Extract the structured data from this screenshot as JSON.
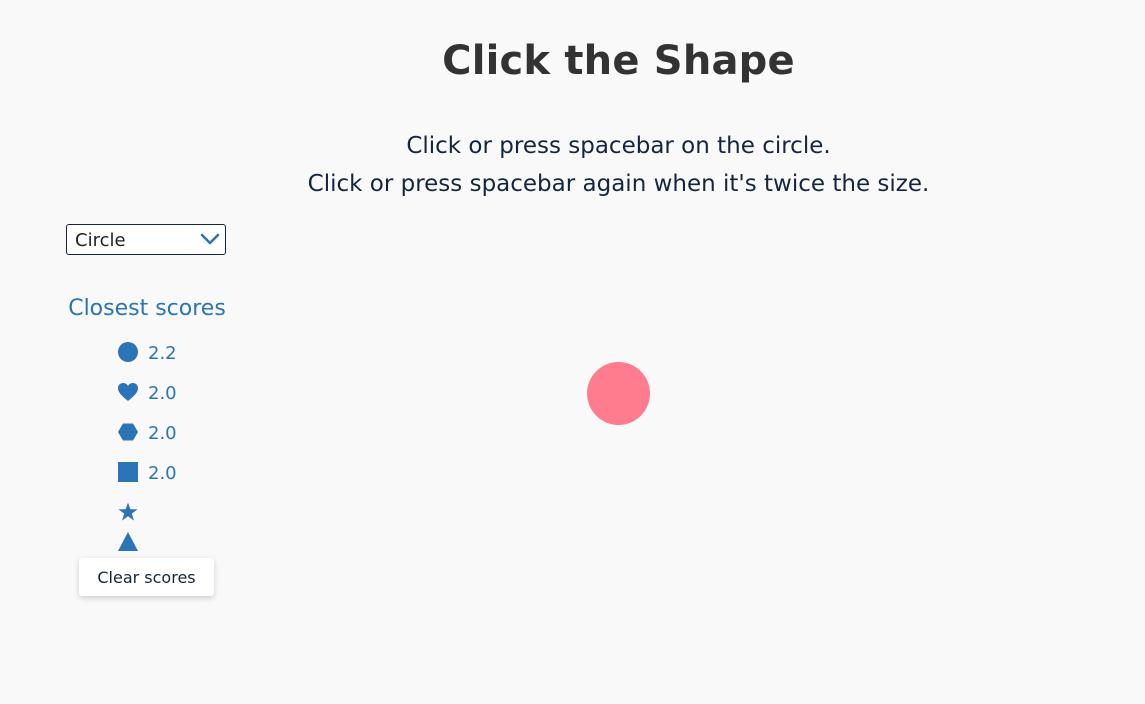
{
  "title": "Click the Shape",
  "instructions": {
    "line1": "Click or press spacebar on the circle.",
    "line2": "Click or press spacebar again when it's twice the size."
  },
  "shape_select": {
    "selected": "Circle",
    "icon": "chevron-down-icon"
  },
  "scores": {
    "heading": "Closest scores",
    "items": [
      {
        "shape": "circle",
        "icon": "circle-icon",
        "value": "2.2"
      },
      {
        "shape": "heart",
        "icon": "heart-icon",
        "value": "2.0"
      },
      {
        "shape": "hexagon",
        "icon": "hexagon-icon",
        "value": "2.0"
      },
      {
        "shape": "square",
        "icon": "square-icon",
        "value": "2.0"
      },
      {
        "shape": "star",
        "icon": "star-icon",
        "value": ""
      },
      {
        "shape": "triangle",
        "icon": "triangle-icon",
        "value": ""
      }
    ],
    "clear_label": "Clear scores"
  },
  "target": {
    "shape": "circle",
    "color": "#ff7b8e"
  },
  "colors": {
    "accent": "#2a74b7",
    "text": "#14263f",
    "background": "#f9f9fa"
  }
}
